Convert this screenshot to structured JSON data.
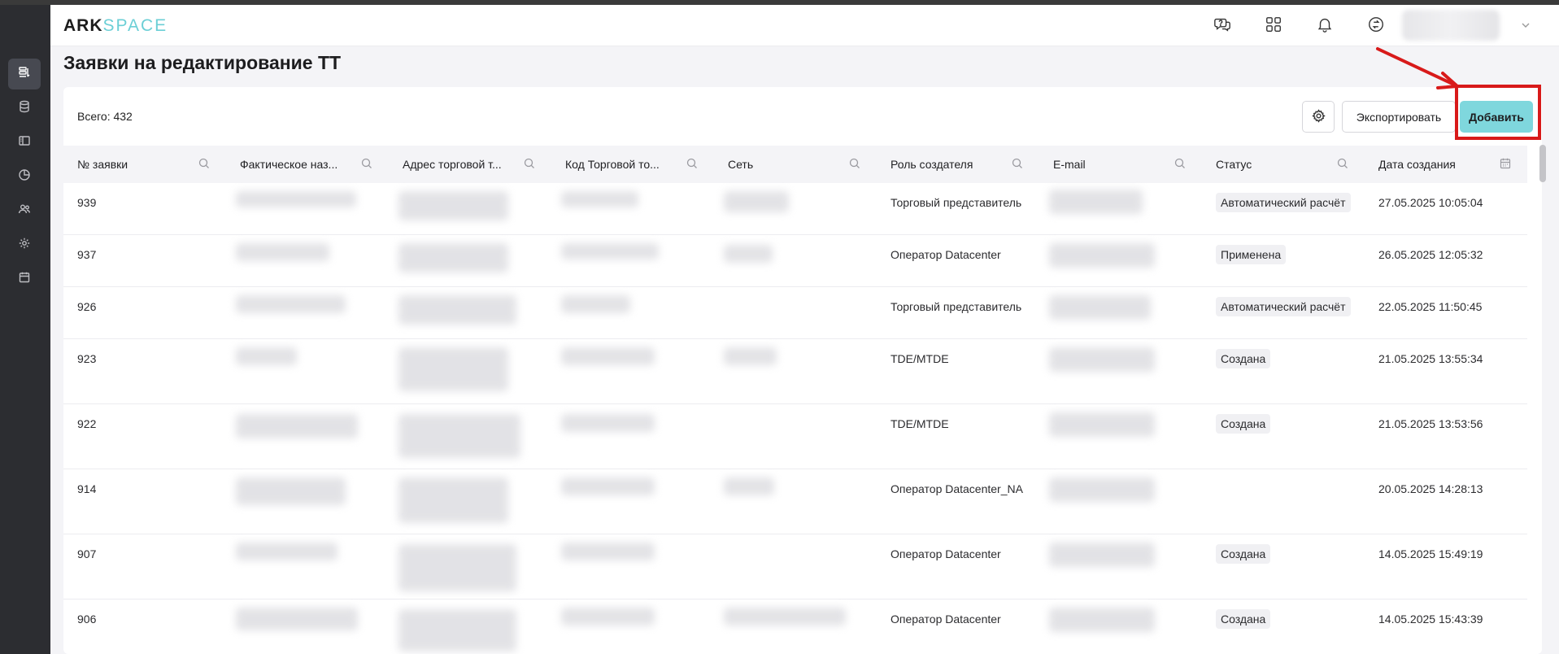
{
  "app": {
    "logo_part1": "ARK",
    "logo_part2": "SPACE"
  },
  "page_title": "Заявки на редактирование ТТ",
  "toolbar": {
    "total": "Всего: 432",
    "export_label": "Экспортировать",
    "add_label": "Добавить"
  },
  "sidebar": {
    "items": [
      {
        "icon": "requests-icon",
        "active": true
      },
      {
        "icon": "database-icon",
        "active": false
      },
      {
        "icon": "layout-icon",
        "active": false
      },
      {
        "icon": "pie-chart-icon",
        "active": false
      },
      {
        "icon": "users-icon",
        "active": false
      },
      {
        "icon": "settings-icon",
        "active": false
      },
      {
        "icon": "calendar-icon",
        "active": false
      }
    ]
  },
  "header_icons": [
    "help-chat-icon",
    "apps-grid-icon",
    "bell-icon",
    "sync-icon"
  ],
  "table": {
    "columns": [
      "№ заявки",
      "Фактическое наз...",
      "Адрес торговой т...",
      "Код Торговой то...",
      "Сеть",
      "Роль создателя",
      "E-mail",
      "Статус",
      "Дата создания"
    ],
    "rows": [
      {
        "id": "939",
        "role": "Торговый представитель",
        "status": "Автоматический расчёт",
        "date": "27.05.2025 10:05:04"
      },
      {
        "id": "937",
        "role": "Оператор Datacenter",
        "status": "Применена",
        "date": "26.05.2025 12:05:32"
      },
      {
        "id": "926",
        "role": "Торговый представитель",
        "status": "Автоматический расчёт",
        "date": "22.05.2025 11:50:45"
      },
      {
        "id": "923",
        "role": "TDE/MTDE",
        "status": "Создана",
        "date": "21.05.2025 13:55:34"
      },
      {
        "id": "922",
        "role": "TDE/MTDE",
        "status": "Создана",
        "date": "21.05.2025 13:53:56"
      },
      {
        "id": "914",
        "role": "Оператор Datacenter_NA",
        "status": "",
        "date": "20.05.2025 14:28:13"
      },
      {
        "id": "907",
        "role": "Оператор Datacenter",
        "status": "Создана",
        "date": "14.05.2025 15:49:19"
      },
      {
        "id": "906",
        "role": "Оператор Datacenter",
        "status": "Создана",
        "date": "14.05.2025 15:43:39"
      }
    ]
  },
  "colors": {
    "accent": "#7fd7dd",
    "sidebar": "#2c2d31",
    "highlight": "#d81a1a"
  }
}
